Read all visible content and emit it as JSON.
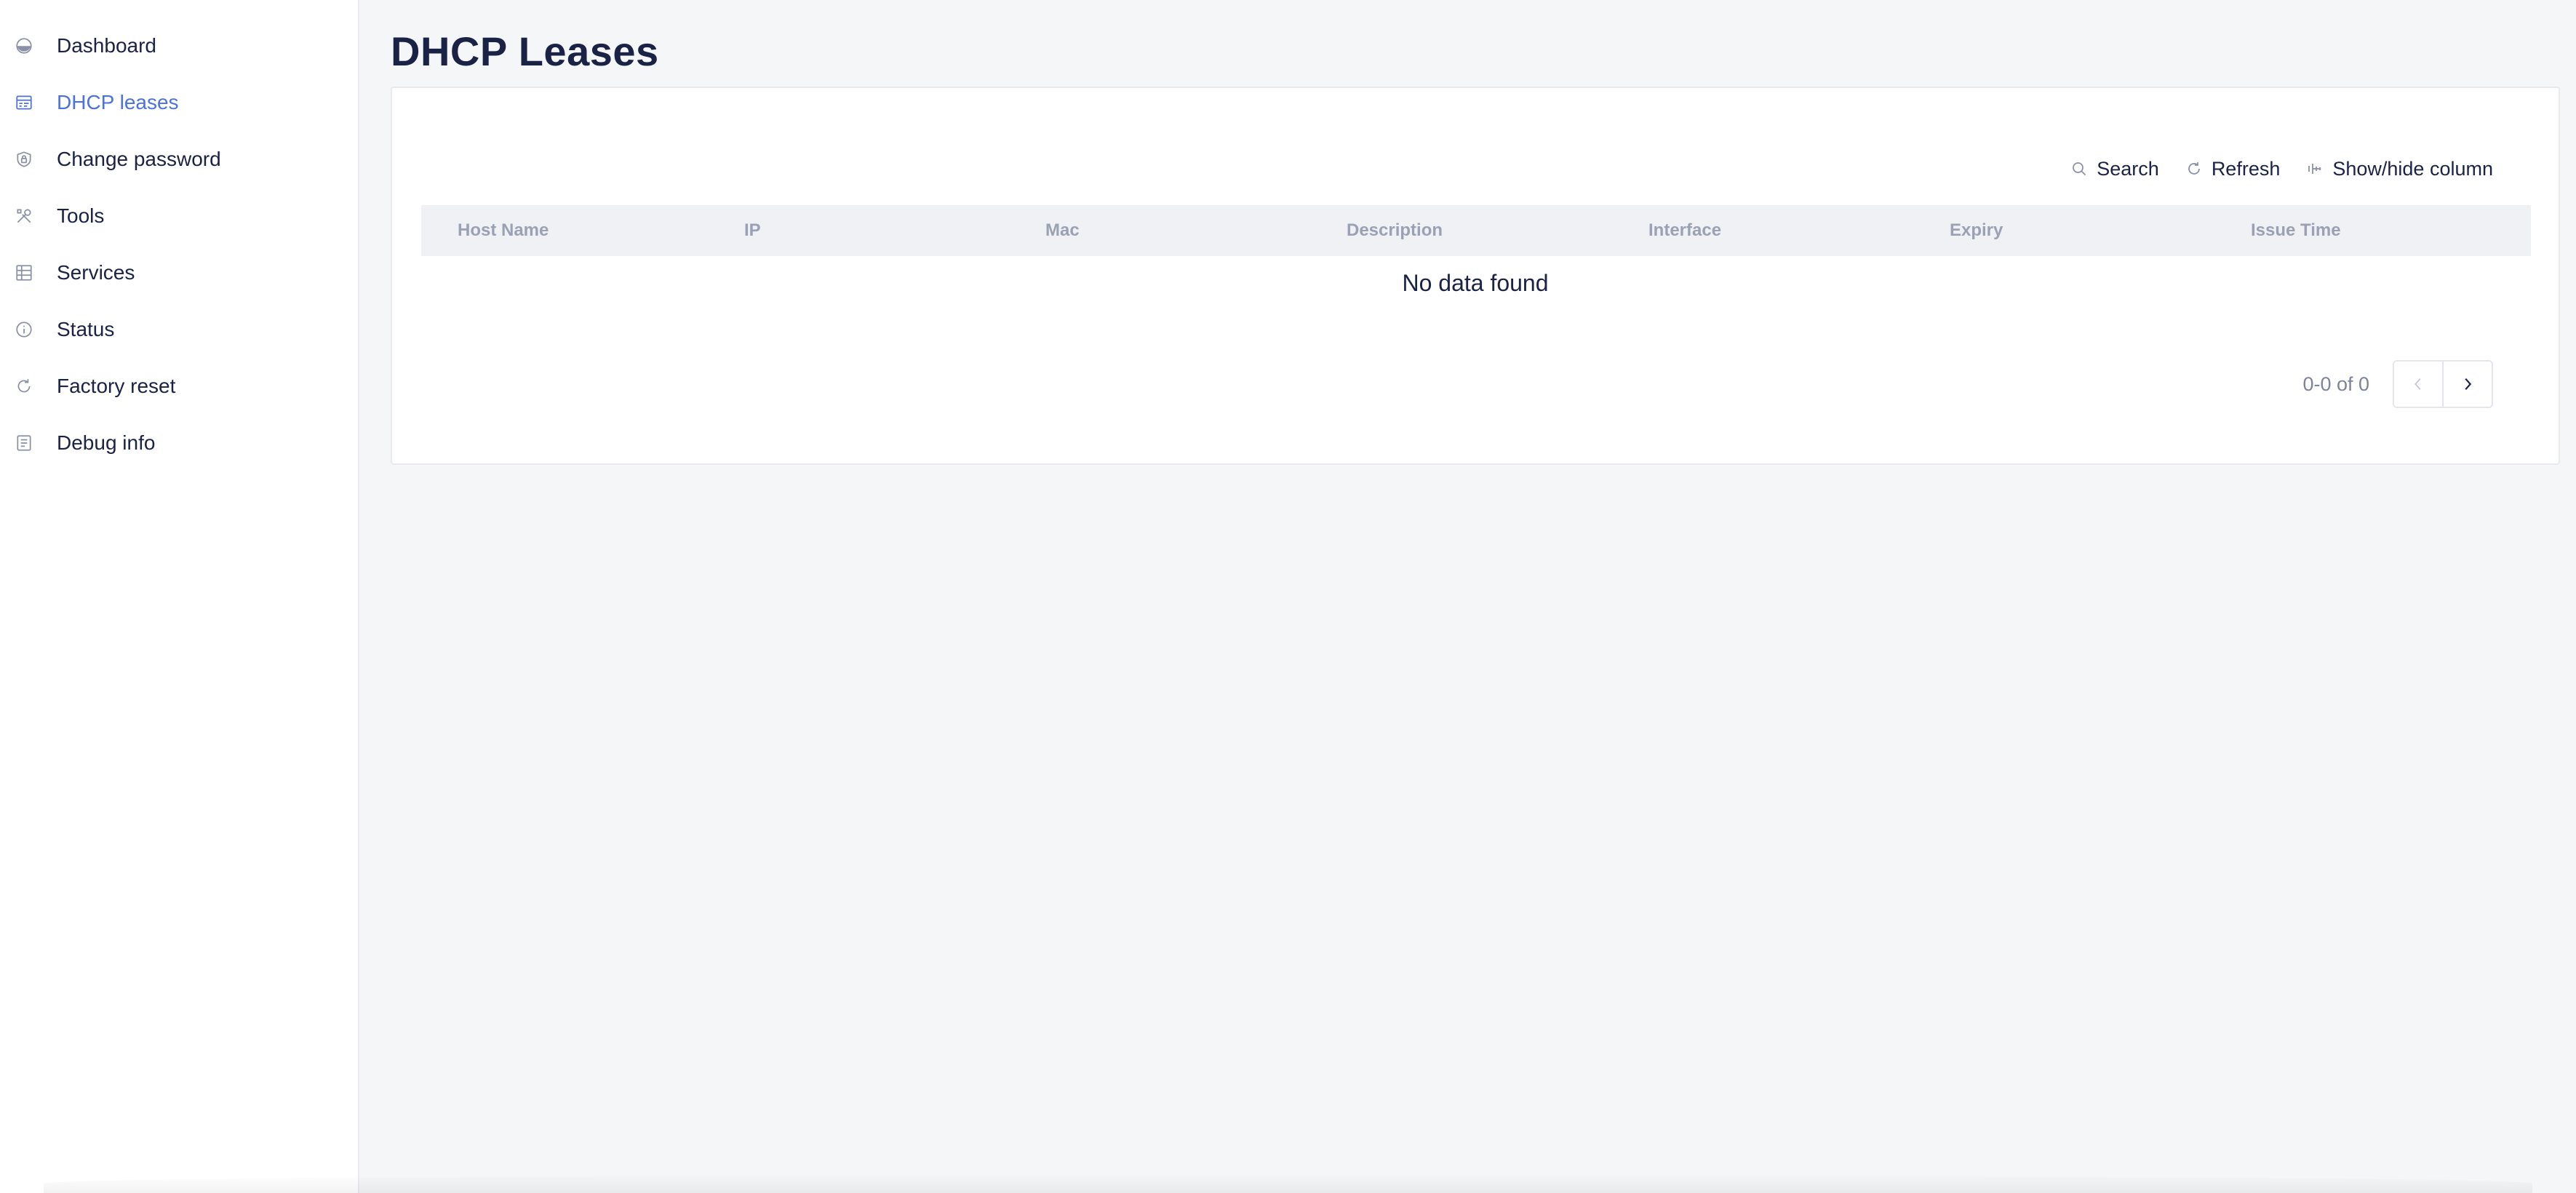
{
  "sidebar": {
    "items": [
      {
        "label": "Dashboard",
        "icon": "dashboard-icon"
      },
      {
        "label": "DHCP leases",
        "icon": "dhcp-leases-icon",
        "active": true
      },
      {
        "label": "Change password",
        "icon": "shield-lock-icon"
      },
      {
        "label": "Tools",
        "icon": "tools-icon"
      },
      {
        "label": "Services",
        "icon": "services-icon"
      },
      {
        "label": "Status",
        "icon": "info-icon"
      },
      {
        "label": "Factory reset",
        "icon": "reset-icon"
      },
      {
        "label": "Debug info",
        "icon": "debug-icon"
      }
    ]
  },
  "main": {
    "title": "DHCP Leases"
  },
  "toolbar": {
    "search_label": "Search",
    "refresh_label": "Refresh",
    "columns_label": "Show/hide column"
  },
  "table": {
    "columns": [
      "Host Name",
      "IP",
      "Mac",
      "Description",
      "Interface",
      "Expiry",
      "Issue Time"
    ],
    "rows": [],
    "empty_message": "No data found"
  },
  "pagination": {
    "range": "0-0 of 0"
  },
  "colors": {
    "accent": "#4a72e0",
    "text": "#1a2246",
    "muted": "#9aa1b4",
    "background": "#f5f6f8"
  }
}
